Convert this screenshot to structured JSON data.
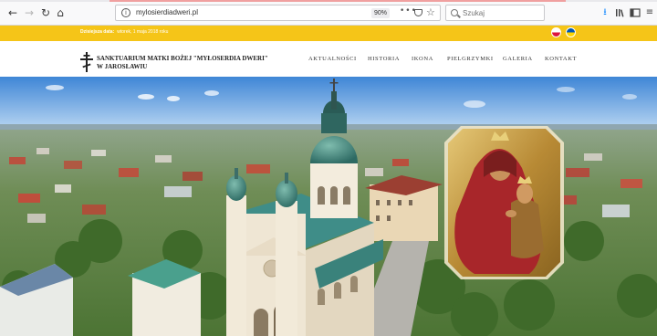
{
  "browser": {
    "url": "mylosierdiadweri.pl",
    "zoom": "90%",
    "page_actions": "•••",
    "search_placeholder": "Szukaj",
    "icons": [
      "back-icon",
      "forward-icon",
      "reload-icon",
      "home-icon",
      "info-icon",
      "pocket-icon",
      "star-icon",
      "search-icon",
      "download-icon",
      "library-icon",
      "sidebar-icon",
      "menu-icon"
    ]
  },
  "topbar": {
    "date_label": "Dzisiejsza data:",
    "date_value": "wtorek, 1 maja 2018 roku",
    "languages": [
      "pl",
      "ua"
    ]
  },
  "header": {
    "title_line1": "SANKTUARIUM MATKI BOŻEJ \"MYŁOSERDIA DWERI\"",
    "title_line2": "W JAROSŁAWIU",
    "nav": [
      "AKTUALNOŚCI",
      "HISTORIA",
      "IKONA",
      "PIELGRZYMKI",
      "GALERIA",
      "KONTAKT"
    ]
  },
  "colors": {
    "yellow": "#f5c518",
    "church_roof": "#3f8d88",
    "icon_gold": "#c8a04a",
    "mary_robe": "#b0262a",
    "sky": "#5a9be0"
  }
}
